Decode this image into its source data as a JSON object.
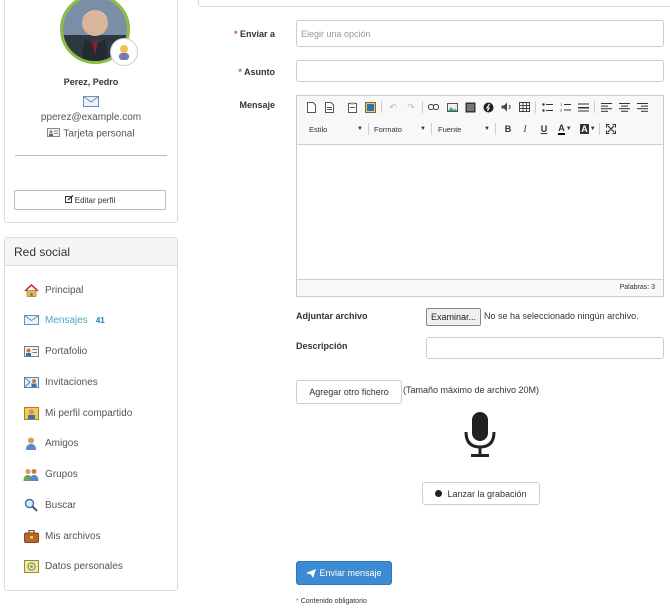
{
  "profile": {
    "name": "Perez, Pedro",
    "email": "pperez@example.com",
    "vcard_label": "Tarjeta personal",
    "edit_label": "Editar perfil"
  },
  "social": {
    "title": "Red social",
    "items": [
      {
        "label": "Principal",
        "icon": "home-icon"
      },
      {
        "label": "Mensajes",
        "icon": "envelope-icon",
        "count": "41",
        "active": true
      },
      {
        "label": "Portafolio",
        "icon": "portfolio-icon"
      },
      {
        "label": "Invitaciones",
        "icon": "invitation-icon"
      },
      {
        "label": "Mi perfil compartido",
        "icon": "shared-profile-icon"
      },
      {
        "label": "Amigos",
        "icon": "friends-icon"
      },
      {
        "label": "Grupos",
        "icon": "groups-icon"
      },
      {
        "label": "Buscar",
        "icon": "search-icon"
      },
      {
        "label": "Mis archivos",
        "icon": "briefcase-icon"
      },
      {
        "label": "Datos personales",
        "icon": "personal-data-icon"
      }
    ]
  },
  "form": {
    "to_label": "Enviar a",
    "to_placeholder": "Elegir una opción",
    "subject_label": "Asunto",
    "subject_value": "",
    "message_label": "Mensaje",
    "toolbar": {
      "style_label": "Estilo",
      "format_label": "Formato",
      "font_label": "Fuente",
      "bold": "B",
      "italic": "I",
      "underline": "U",
      "text_color": "A",
      "bg_color": "A"
    },
    "word_count": "Palabras: 3",
    "attach_label": "Adjuntar archivo",
    "browse_label": "Examinar...",
    "no_file_text": "No se ha seleccionado ningún archivo.",
    "description_label": "Descripción",
    "add_file_label": "Agregar otro fichero",
    "max_size_text": "(Tamaño máximo de archivo 20M)",
    "record_label": "Lanzar la grabación",
    "send_label": "Enviar mensaje",
    "required_note": "Contenido obligatorio",
    "required_mark": "*"
  },
  "colors": {
    "accent": "#3d8bd0",
    "active_link": "#4aa8c4",
    "required": "#d9534f",
    "avatar_ring": "#8cbd3f"
  }
}
